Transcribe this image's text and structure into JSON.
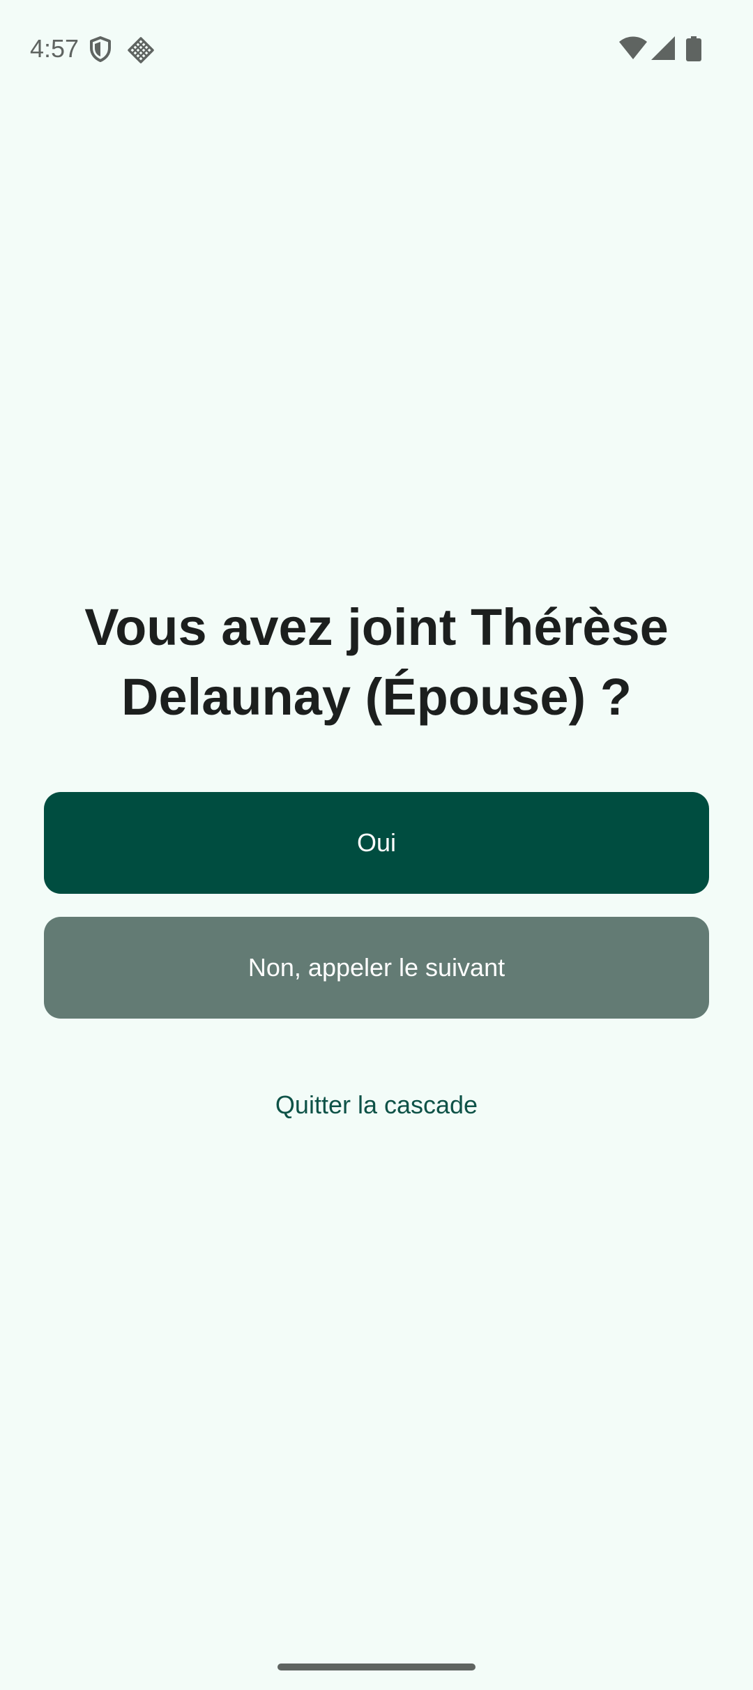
{
  "status_bar": {
    "time": "4:57",
    "left_icons": [
      "shield-icon",
      "diamond-grid-icon"
    ],
    "right_icons": [
      "wifi-icon",
      "signal-icon",
      "battery-icon"
    ]
  },
  "dialog": {
    "title": "Vous avez joint Thérèse Delaunay (Épouse) ?",
    "primary_button": "Oui",
    "secondary_button": "Non, appeler le suivant",
    "link": "Quitter la cascade"
  },
  "colors": {
    "background": "#f3fcf8",
    "primary": "#004d40",
    "secondary": "#637b74",
    "link": "#0e5247",
    "title": "#1c1f1e"
  }
}
